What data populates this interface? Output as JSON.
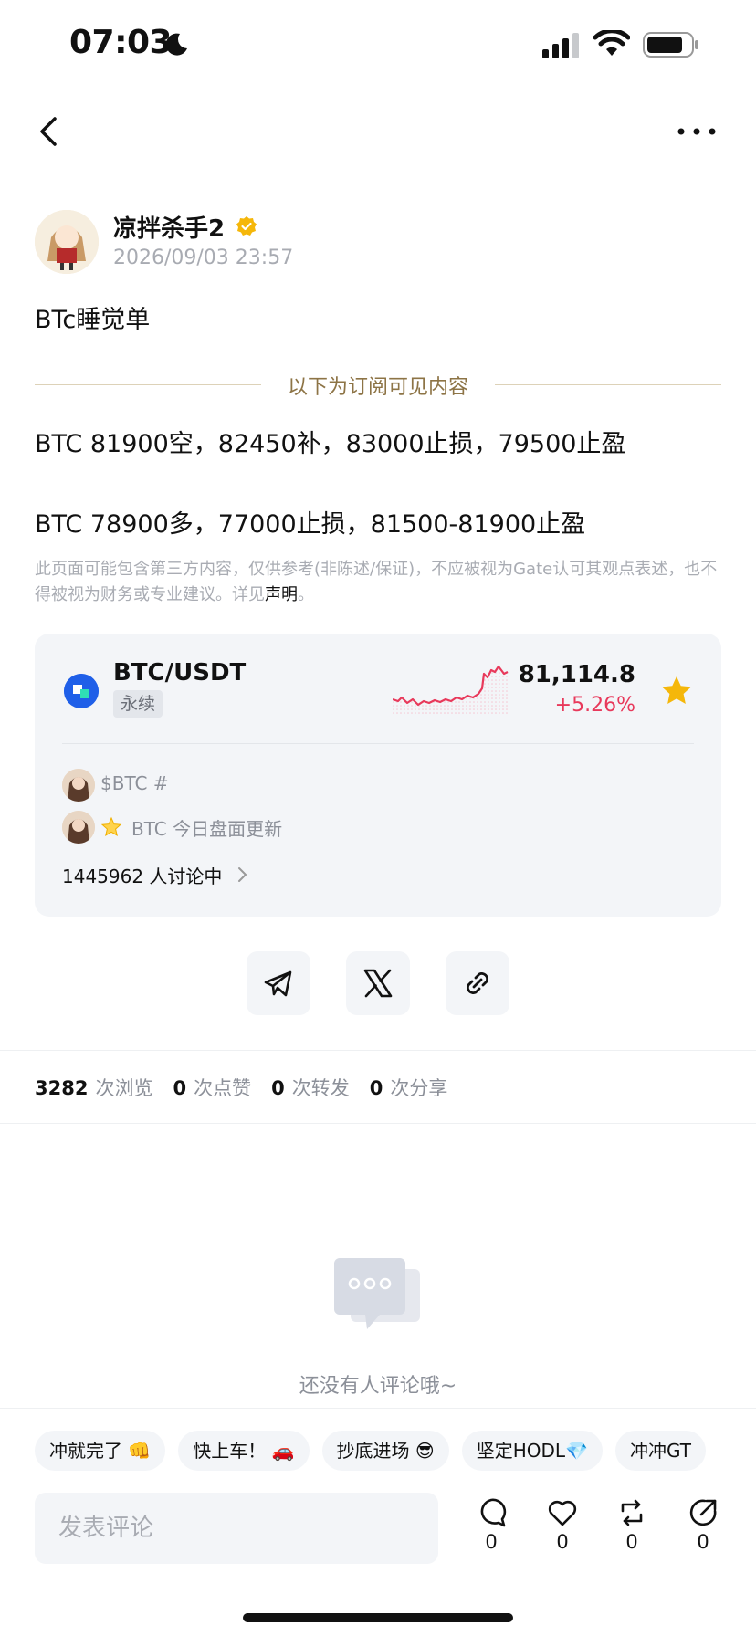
{
  "status_bar": {
    "time": "07:03"
  },
  "post": {
    "author": "凉拌杀手2",
    "date": "2026/09/03 23:57",
    "title": "BTc睡觉单",
    "subscriber_divider": "以下为订阅可见内容",
    "lines": [
      "BTC 81900空，82450补，83000止损，79500止盈",
      "BTC 78900多，77000止损，81500-81900止盈"
    ],
    "disclaimer": "此页面可能包含第三方内容，仅供参考(非陈述/保证)，不应被视为Gate认可其观点表述，也不得被视为财务或专业建议。详见",
    "disclaimer_link": "声明",
    "disclaimer_end": "。"
  },
  "market_card": {
    "pair": "BTC/USDT",
    "badge": "永续",
    "price": "81,114.8",
    "change": "+5.26%",
    "feed": [
      {
        "text": "$BTC #"
      },
      {
        "text": "BTC 今日盘面更新"
      }
    ],
    "discussion": "1445962 人讨论中",
    "colors": {
      "up": "#e8395b",
      "coin": "#1f5fe8",
      "star": "#f5b70a"
    }
  },
  "share_icons": [
    "telegram-icon",
    "x-icon",
    "link-icon"
  ],
  "stats": [
    {
      "value": "3282",
      "label": "次浏览"
    },
    {
      "value": "0",
      "label": "次点赞"
    },
    {
      "value": "0",
      "label": "次转发"
    },
    {
      "value": "0",
      "label": "次分享"
    }
  ],
  "empty_state": {
    "text": "还没有人评论哦~"
  },
  "chips": [
    "冲就完了 👊",
    "快上车！ 🚗",
    "抄底进场 😎",
    "坚定HODL💎",
    "冲冲GT"
  ],
  "comment": {
    "placeholder": "发表评论"
  },
  "actions": [
    {
      "icon": "comment-icon",
      "count": "0"
    },
    {
      "icon": "like-icon",
      "count": "0"
    },
    {
      "icon": "repost-icon",
      "count": "0"
    },
    {
      "icon": "share-icon",
      "count": "0"
    }
  ]
}
